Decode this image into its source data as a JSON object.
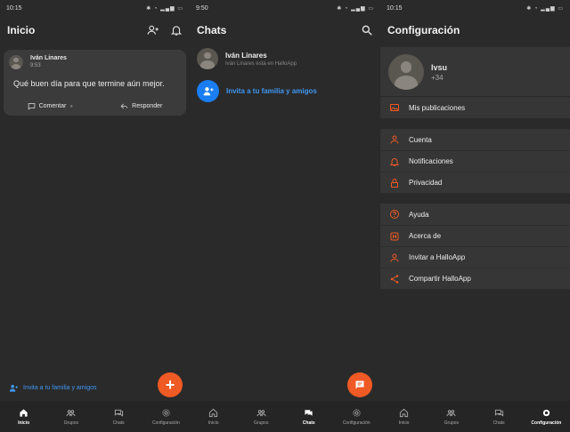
{
  "accent": "#f05a24",
  "link_color": "#3f97f0",
  "panel1": {
    "time": "10:15",
    "title": "Inicio",
    "post": {
      "author": "Iván Linares",
      "time": "9:53",
      "text": "Qué buen día para que termine aún mejor.",
      "comment_label": "Comentar",
      "reply_label": "Responder"
    },
    "invite_label": "Invita a tu familia y amigos",
    "fab_label": "+"
  },
  "panel2": {
    "time": "9:50",
    "title": "Chats",
    "chat": {
      "name": "Iván Linares",
      "subtitle": "Iván Linares está en HalloApp"
    },
    "invite_label": "Invita a tu familia y amigos"
  },
  "panel3": {
    "time": "10:15",
    "title": "Configuración",
    "profile": {
      "name": "Ivsu",
      "phone": "+34"
    },
    "groups": [
      [
        {
          "label": "Mis publicaciones",
          "icon": "image-icon"
        }
      ],
      [
        {
          "label": "Cuenta",
          "icon": "person-icon"
        },
        {
          "label": "Notificaciones",
          "icon": "bell-icon"
        },
        {
          "label": "Privacidad",
          "icon": "lock-icon"
        }
      ],
      [
        {
          "label": "Ayuda",
          "icon": "help-icon"
        },
        {
          "label": "Acerca de",
          "icon": "info-icon"
        },
        {
          "label": "Invitar a HalloApp",
          "icon": "person-icon"
        },
        {
          "label": "Compartir HalloApp",
          "icon": "share-icon"
        }
      ]
    ]
  },
  "nav": [
    "Inicio",
    "Grupos",
    "Chats",
    "Configuración"
  ]
}
